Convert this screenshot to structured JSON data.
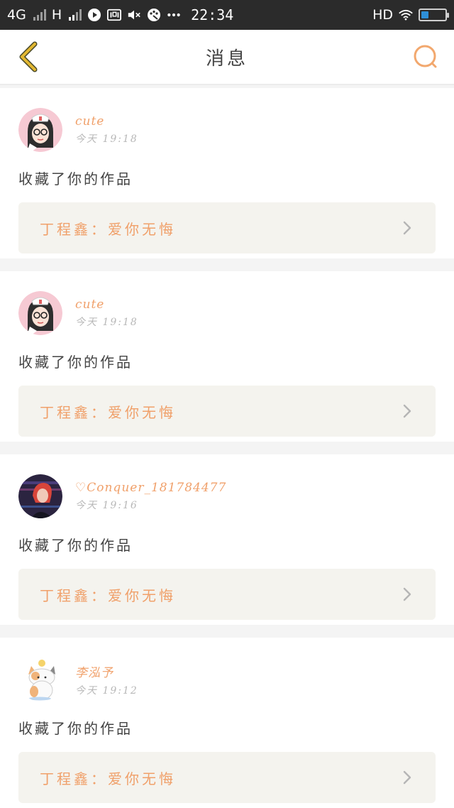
{
  "status_bar": {
    "network_1": "4G",
    "network_2": "H",
    "time": "22:34",
    "hd_label": "HD",
    "battery_level": 0.3,
    "icons": [
      "signal-icon",
      "play-icon",
      "iqiyi-icon",
      "mute-icon",
      "paint-icon",
      "more-dots-icon",
      "wifi-icon",
      "battery-icon"
    ]
  },
  "nav": {
    "title": "消息",
    "back_icon": "chevron-left-icon",
    "search_icon": "search-icon"
  },
  "colors": {
    "accent": "#f0a06a",
    "back_arrow": "#e2b731",
    "search_ring": "#f2a86e",
    "work_box_bg": "#f4f3ee"
  },
  "notifications": [
    {
      "username": "cute",
      "time": "今天 19:18",
      "action": "收藏了你的作品",
      "work": "丁程鑫：爱你无悔",
      "avatar": "girl-glasses-avatar"
    },
    {
      "username": "cute",
      "time": "今天 19:18",
      "action": "收藏了你的作品",
      "work": "丁程鑫：爱你无悔",
      "avatar": "girl-glasses-avatar"
    },
    {
      "username": "♡Conquer_181784477",
      "time": "今天 19:16",
      "action": "收藏了你的作品",
      "work": "丁程鑫：爱你无悔",
      "avatar": "red-hair-avatar"
    },
    {
      "username": "李泓予",
      "time": "今天 19:12",
      "action": "收藏了你的作品",
      "work": "丁程鑫：爱你无悔",
      "avatar": "cat-avatar"
    }
  ]
}
